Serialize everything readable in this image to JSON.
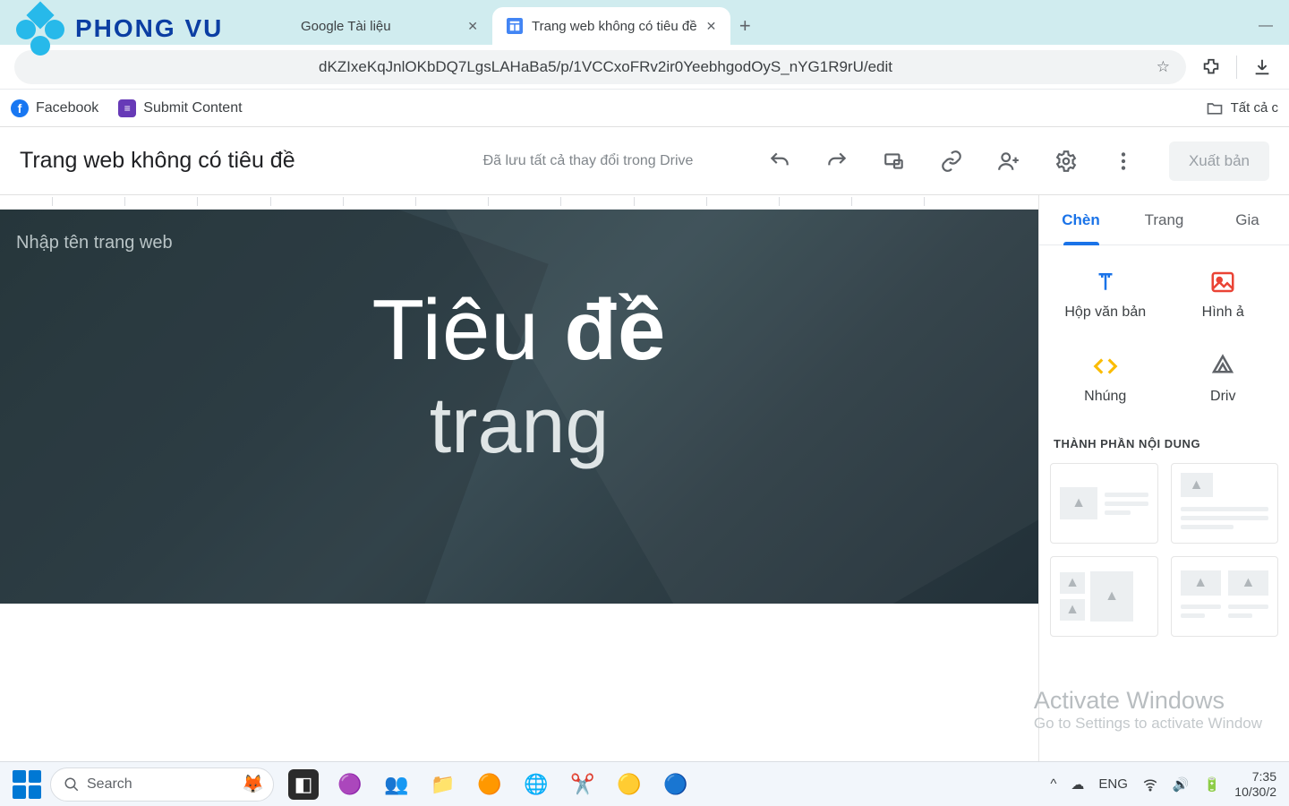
{
  "logo": {
    "text": "PHONG VU"
  },
  "tabs": [
    {
      "title": "Google Tài liệu",
      "active": false
    },
    {
      "title": "Trang web không có tiêu đề",
      "active": true
    }
  ],
  "addressbar": {
    "url_fragment": "dKZIxeKqJnlOKbDQ7LgsLAHaBa5/p/1VCCxoFRv2ir0YeebhgodOyS_nYG1R9rU/edit"
  },
  "bookmarks": {
    "items": [
      {
        "label": "Facebook"
      },
      {
        "label": "Submit Content"
      }
    ],
    "all_label": "Tất cả c"
  },
  "app_header": {
    "doc_title": "Trang web không có tiêu đề",
    "save_status": "Đã lưu tất cả thay đổi trong Drive",
    "publish_label": "Xuất bản"
  },
  "canvas": {
    "site_name_placeholder": "Nhập tên trang web",
    "page_title_line1a": "Tiêu ",
    "page_title_line1b": "đề",
    "page_title_line2": "trang"
  },
  "sidepanel": {
    "tabs": [
      {
        "label": "Chèn",
        "active": true
      },
      {
        "label": "Trang",
        "active": false
      },
      {
        "label": "Gia",
        "active": false
      }
    ],
    "insert_items": [
      {
        "label": "Hộp văn bản",
        "icon": "text-icon"
      },
      {
        "label": "Hình ả",
        "icon": "image-icon"
      },
      {
        "label": "Nhúng",
        "icon": "embed-icon"
      },
      {
        "label": "Driv",
        "icon": "drive-icon"
      }
    ],
    "section_label": "THÀNH PHẦN NỘI DUNG"
  },
  "watermark": {
    "line1": "Activate Windows",
    "line2": "Go to Settings to activate Window"
  },
  "taskbar": {
    "search_placeholder": "Search",
    "lang": "ENG",
    "time": "7:35",
    "date": "10/30/2"
  }
}
